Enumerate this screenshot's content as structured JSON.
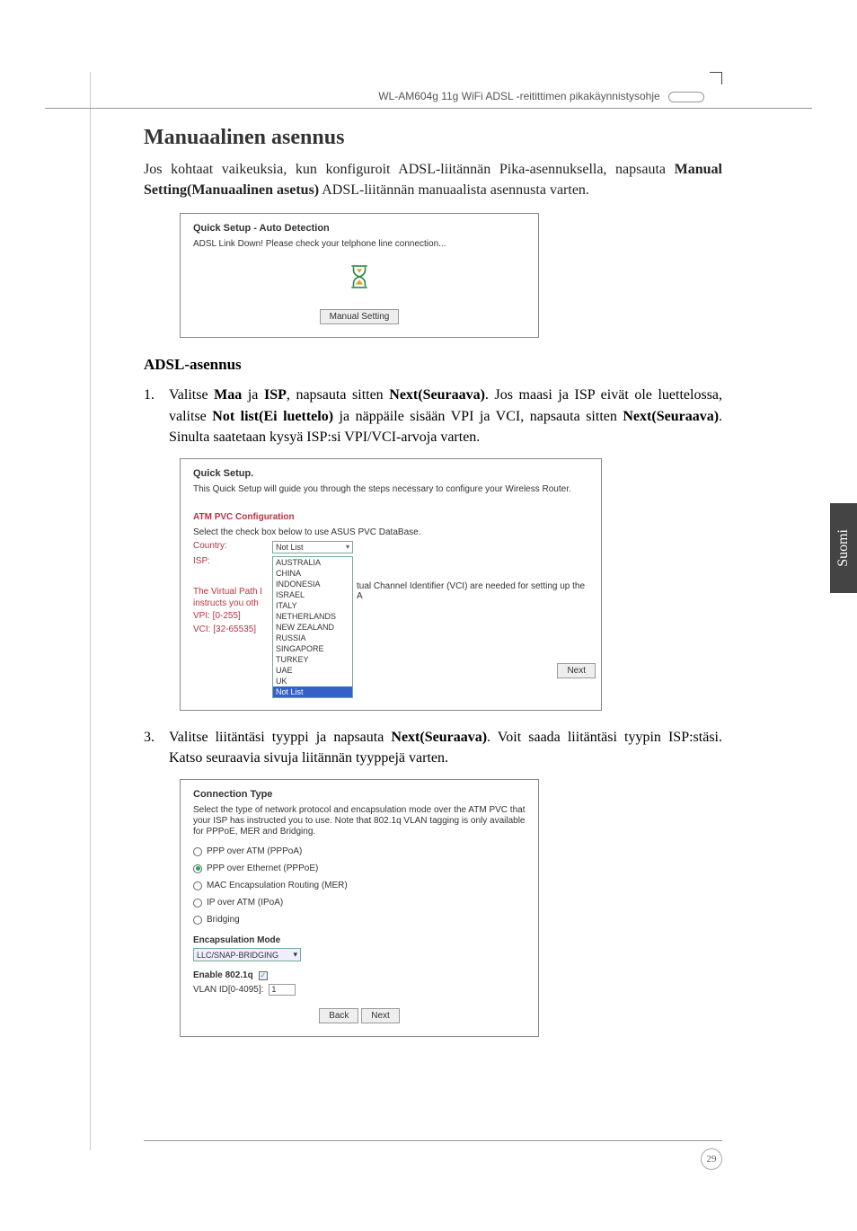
{
  "header": {
    "product": "WL-AM604g 11g WiFi ADSL -reitittimen pikakäynnistysohje"
  },
  "section": {
    "title": "Manuaalinen asennus",
    "intro_part1": "Jos kohtaat vaikeuksia, kun konfiguroit ADSL-liitännän Pika-asennuksella, napsauta ",
    "intro_bold": "Manual Setting(Manuaalinen asetus)",
    "intro_part2": " ADSL-liitännän manuaalista asennusta varten."
  },
  "ss1": {
    "title": "Quick Setup - Auto Detection",
    "message": "ADSL Link Down! Please check your telphone line connection...",
    "button": "Manual Setting"
  },
  "subsection": {
    "title": "ADSL-asennus"
  },
  "step1": {
    "num": "1.",
    "t1": "Valitse ",
    "b1": "Maa",
    "t2": " ja ",
    "b2": "ISP",
    "t3": ", napsauta sitten ",
    "b3": "Next(Seuraava)",
    "t4": ". Jos maasi ja ISP eivät ole luettelossa, valitse ",
    "b4": "Not list(Ei luettelo)",
    "t5": " ja näppäile sisään VPI ja VCI, napsauta sitten ",
    "b5": "Next(Seuraava)",
    "t6": ". Sinulta saatetaan kysyä ISP:si VPI/VCI-arvoja varten."
  },
  "ss2": {
    "title": "Quick Setup.",
    "desc": "This Quick Setup will guide you through the steps necessary to configure your Wireless Router.",
    "sub": "ATM PVC Configuration",
    "select_hint": "Select the check box below to use ASUS PVC DataBase.",
    "country_lbl": "Country:",
    "country_val": "Not List",
    "isp_lbl": "ISP:",
    "vpath_row": "The Virtual Path I",
    "vpath_row2": "instructs you oth",
    "vpi_lbl": "VPI: [0-255]",
    "vci_lbl": "VCI: [32-65535]",
    "vci_right": "tual Channel Identifier (VCI) are needed for setting up the A",
    "options": [
      "AUSTRALIA",
      "CHINA",
      "INDONESIA",
      "ISRAEL",
      "ITALY",
      "NETHERLANDS",
      "NEW ZEALAND",
      "RUSSIA",
      "SINGAPORE",
      "TURKEY",
      "UAE",
      "UK",
      "Not List"
    ],
    "next": "Next"
  },
  "step3": {
    "num": "3.",
    "t1": "Valitse liitäntäsi tyyppi ja napsauta ",
    "b1": "Next(Seuraava)",
    "t2": ". Voit saada liitäntäsi tyypin ISP:stäsi. Katso seuraavia sivuja liitännän tyyppejä varten."
  },
  "ss3": {
    "title": "Connection Type",
    "desc": "Select the type of network protocol and encapsulation mode over the ATM PVC that your ISP has instructed you to use. Note that 802.1q VLAN tagging is only available for PPPoE, MER and Bridging.",
    "r1": "PPP over ATM (PPPoA)",
    "r2": "PPP over Ethernet (PPPoE)",
    "r3": "MAC Encapsulation Routing (MER)",
    "r4": "IP over ATM (IPoA)",
    "r5": "Bridging",
    "enc_title": "Encapsulation Mode",
    "enc_val": "LLC/SNAP-BRIDGING",
    "enable_lbl": "Enable 802.1q",
    "vlan_lbl": "VLAN ID[0-4095]:",
    "vlan_val": "1",
    "back": "Back",
    "next": "Next"
  },
  "side_tab": "Suomi",
  "page_number": "29"
}
